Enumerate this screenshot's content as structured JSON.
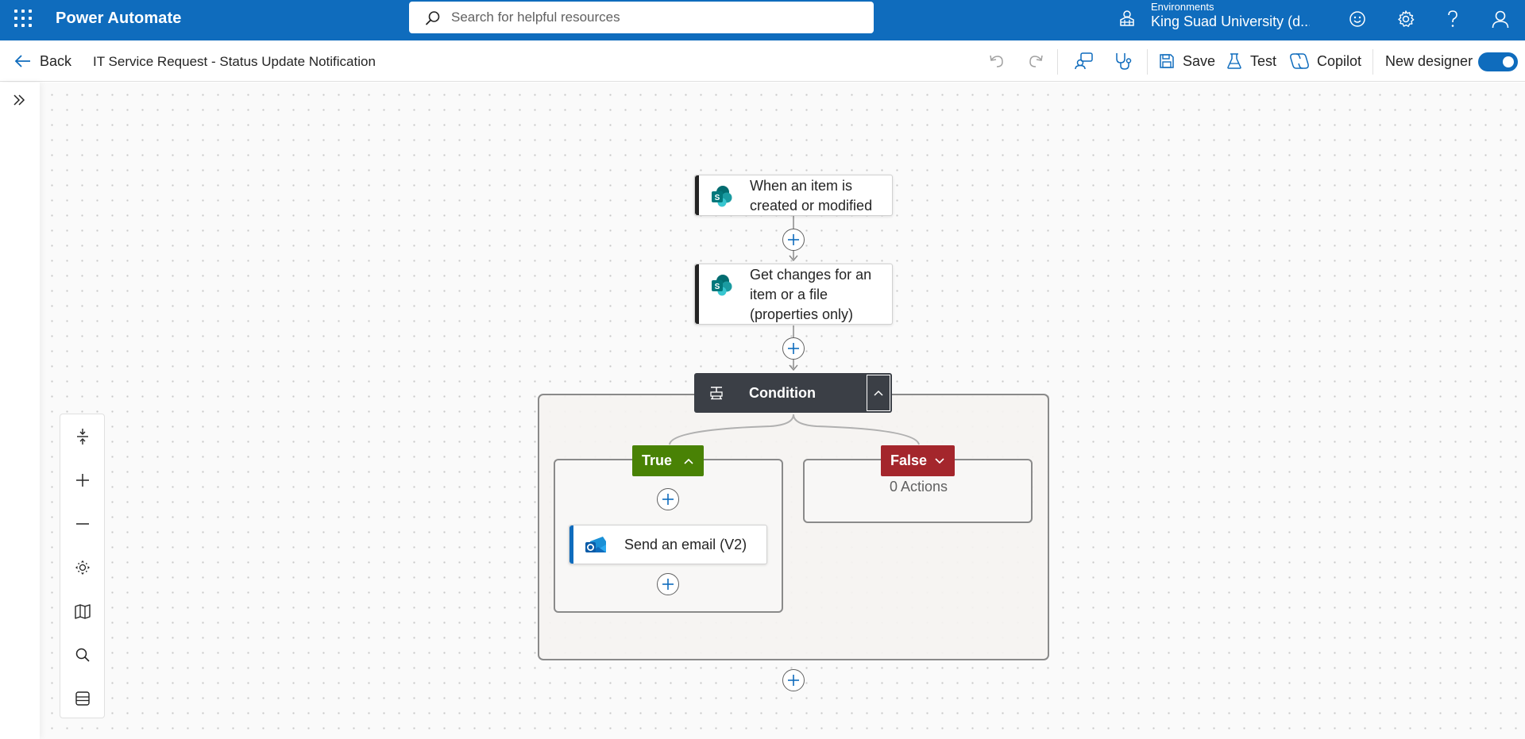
{
  "header": {
    "app_title": "Power Automate",
    "search_placeholder": "Search for helpful resources",
    "environment_label": "Environments",
    "environment_name": "King Suad University (d...",
    "icons": [
      "waffle-icon",
      "search-icon",
      "environment-icon",
      "smiley-icon",
      "gear-icon",
      "help-icon",
      "person-icon"
    ],
    "brand_color": "#0f6cbd"
  },
  "commandbar": {
    "back_label": "Back",
    "flow_title": "IT Service Request - Status Update Notification",
    "save_label": "Save",
    "test_label": "Test",
    "copilot_label": "Copilot",
    "new_designer_label": "New designer",
    "new_designer_enabled": true
  },
  "flow": {
    "trigger": {
      "title": "When an item is created or modified",
      "line1": "When an item is",
      "line2": "created or modified",
      "connector": "SharePoint"
    },
    "action1": {
      "title": "Get changes for an item or a file (properties only)",
      "line1": "Get changes for an",
      "line2": "item or a file",
      "line3": "(properties only)",
      "connector": "SharePoint"
    },
    "condition": {
      "label": "Condition",
      "true_branch": {
        "label": "True",
        "color": "#498205",
        "actions": [
          {
            "title": "Send an email (V2)",
            "connector": "Office 365 Outlook"
          }
        ]
      },
      "false_branch": {
        "label": "False",
        "color": "#a4262c",
        "actions_text": "0 Actions"
      }
    }
  },
  "canvas_tools": [
    "fit-vertical-icon",
    "zoom-in-icon",
    "zoom-out-icon",
    "fit-view-icon",
    "minimap-icon",
    "search-icon",
    "panel-icon"
  ]
}
